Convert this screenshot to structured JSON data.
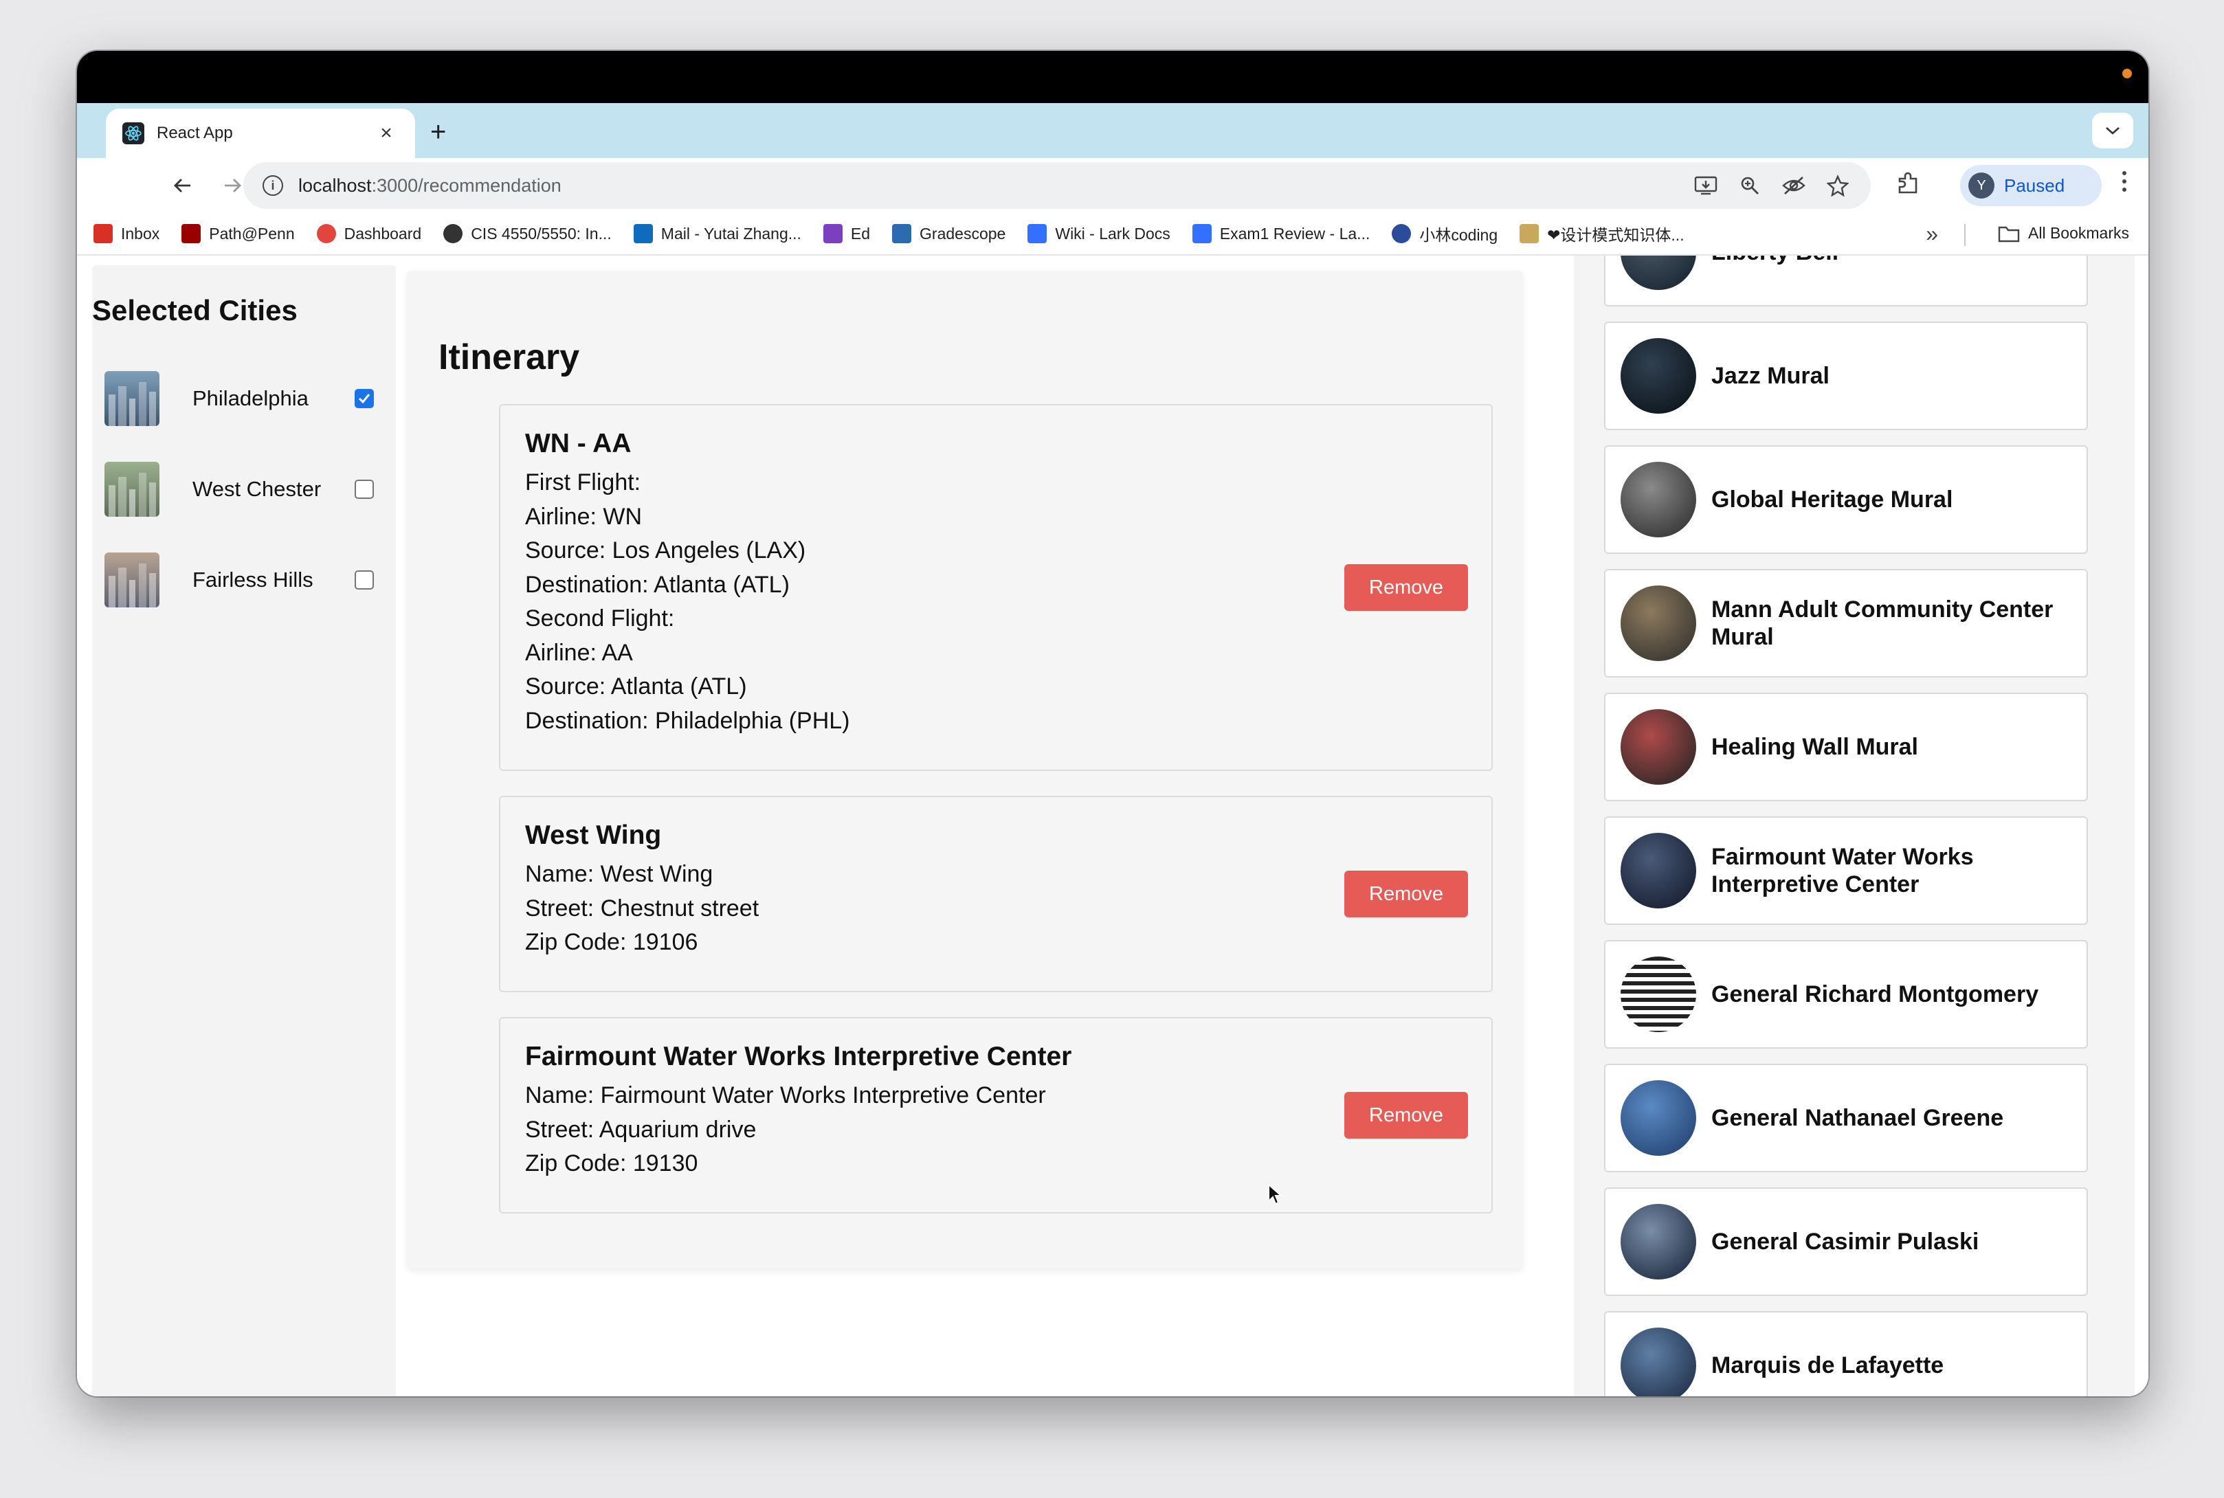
{
  "browser": {
    "tab_title": "React App",
    "tab_close": "×",
    "new_tab": "+",
    "url_host": "localhost",
    "url_path": ":3000/recommendation",
    "profile_initial": "Y",
    "profile_status": "Paused",
    "bookmarks": [
      {
        "label": "Inbox",
        "icon": "gmail-icon",
        "color": "#d93025"
      },
      {
        "label": "Path@Penn",
        "icon": "path-penn-icon",
        "color": "#990000"
      },
      {
        "label": "Dashboard",
        "icon": "dashboard-icon",
        "color": "#e2453c"
      },
      {
        "label": "CIS 4550/5550: In...",
        "icon": "globe-icon",
        "color": "#333333"
      },
      {
        "label": "Mail - Yutai Zhang...",
        "icon": "outlook-icon",
        "color": "#0f6cbd"
      },
      {
        "label": "Ed",
        "icon": "ed-icon",
        "color": "#7b3fbf"
      },
      {
        "label": "Gradescope",
        "icon": "gradescope-icon",
        "color": "#2b6cb0"
      },
      {
        "label": "Wiki - Lark Docs",
        "icon": "lark-icon",
        "color": "#3370ff"
      },
      {
        "label": "Exam1 Review - La...",
        "icon": "doc-icon",
        "color": "#3370ff"
      },
      {
        "label": "小林coding",
        "icon": "xiaolin-icon",
        "color": "#2b4c9a"
      },
      {
        "label": "❤设计模式知识体...",
        "icon": "avatar-bookmark-icon",
        "color": "#c9a85c"
      }
    ],
    "bookmarks_more": "»",
    "all_bookmarks": "All Bookmarks"
  },
  "sidebar": {
    "title": "Selected Cities",
    "cities": [
      {
        "name": "Philadelphia",
        "checked": true
      },
      {
        "name": "West Chester",
        "checked": false
      },
      {
        "name": "Fairless Hills",
        "checked": false
      }
    ]
  },
  "itinerary": {
    "title": "Itinerary",
    "remove_label": "Remove",
    "cards": [
      {
        "title": "WN - AA",
        "lines": [
          "First Flight:",
          "Airline: WN",
          "Source: Los Angeles (LAX)",
          "Destination: Atlanta (ATL)",
          "Second Flight:",
          "Airline: AA",
          "Source: Atlanta (ATL)",
          "Destination: Philadelphia (PHL)"
        ]
      },
      {
        "title": "West Wing",
        "lines": [
          "Name: West Wing",
          "Street: Chestnut street",
          "Zip Code: 19106"
        ]
      },
      {
        "title": "Fairmount Water Works Interpretive Center",
        "lines": [
          "Name: Fairmount Water Works Interpretive Center",
          "Street: Aquarium drive",
          "Zip Code: 19130"
        ]
      }
    ]
  },
  "recommendations": [
    {
      "name": "Liberty Bell"
    },
    {
      "name": "Jazz Mural"
    },
    {
      "name": "Global Heritage Mural"
    },
    {
      "name": "Mann Adult Community Center Mural"
    },
    {
      "name": "Healing Wall Mural"
    },
    {
      "name": "Fairmount Water Works Interpretive Center"
    },
    {
      "name": "General Richard Montgomery"
    },
    {
      "name": "General Nathanael Greene"
    },
    {
      "name": "General Casimir Pulaski"
    },
    {
      "name": "Marquis de Lafayette"
    }
  ],
  "colors": {
    "remove_button": "#e65b55",
    "checkbox_checked": "#1a73e8",
    "tab_strip": "#c3e3f1"
  }
}
